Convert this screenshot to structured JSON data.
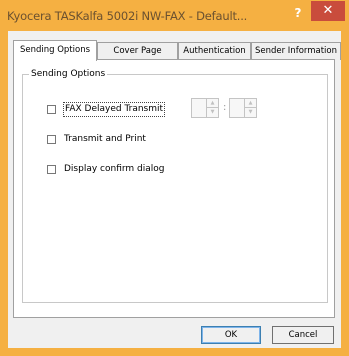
{
  "window": {
    "title": "Kyocera TASKalfa 5002i NW-FAX - Default...",
    "help_label": "?",
    "close_label": "✕",
    "colors": {
      "title_bar": "#f5b042",
      "close_button": "#c94c3c"
    }
  },
  "tabs": [
    {
      "label": "Sending Options",
      "active": true
    },
    {
      "label": "Cover Page",
      "active": false
    },
    {
      "label": "Authentication",
      "active": false
    },
    {
      "label": "Sender Information",
      "active": false
    }
  ],
  "sending_options": {
    "group_label": "Sending Options",
    "options": [
      {
        "label": "FAX Delayed Transmit",
        "checked": false,
        "enabled": true
      },
      {
        "label": "Transmit and Print",
        "checked": false,
        "enabled": true
      },
      {
        "label": "Display confirm dialog",
        "checked": false,
        "enabled": true
      }
    ],
    "time_separator": ":"
  },
  "buttons": {
    "ok_label": "OK",
    "cancel_label": "Cancel"
  },
  "icons": [
    "help-icon",
    "close-icon",
    "spin-up-icon",
    "spin-down-icon"
  ]
}
